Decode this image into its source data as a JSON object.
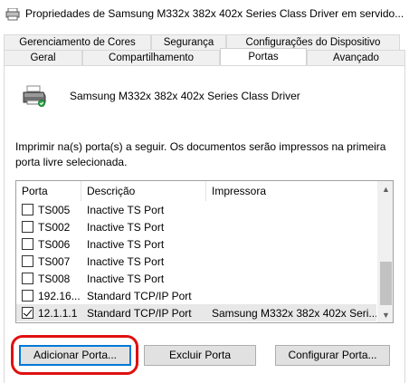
{
  "window": {
    "title": "Propriedades de Samsung M332x 382x 402x Series Class Driver em servido..."
  },
  "tabs": {
    "row1": [
      {
        "label": "Gerenciamento de Cores"
      },
      {
        "label": "Segurança"
      },
      {
        "label": "Configurações do Dispositivo"
      }
    ],
    "row2": [
      {
        "label": "Geral"
      },
      {
        "label": "Compartilhamento"
      },
      {
        "label": "Portas",
        "active": true
      },
      {
        "label": "Avançado"
      }
    ]
  },
  "driver": {
    "name": "Samsung M332x 382x 402x Series Class Driver",
    "icon": "printer-icon"
  },
  "instruction": "Imprimir na(s) porta(s) a seguir. Os documentos serão impressos na primeira porta livre selecionada.",
  "ports_list": {
    "columns": [
      "Porta",
      "Descrição",
      "Impressora"
    ],
    "rows": [
      {
        "checked": false,
        "port": "TS005",
        "description": "Inactive TS Port",
        "printer": ""
      },
      {
        "checked": false,
        "port": "TS002",
        "description": "Inactive TS Port",
        "printer": ""
      },
      {
        "checked": false,
        "port": "TS006",
        "description": "Inactive TS Port",
        "printer": ""
      },
      {
        "checked": false,
        "port": "TS007",
        "description": "Inactive TS Port",
        "printer": ""
      },
      {
        "checked": false,
        "port": "TS008",
        "description": "Inactive TS Port",
        "printer": ""
      },
      {
        "checked": false,
        "port": "192.16...",
        "description": "Standard TCP/IP Port",
        "printer": ""
      },
      {
        "checked": true,
        "port": "12.1.1.1",
        "description": "Standard TCP/IP Port",
        "printer": "Samsung M332x 382x 402x Seri..."
      }
    ]
  },
  "buttons": {
    "add_port": "Adicionar Porta...",
    "delete_port": "Excluir Porta",
    "configure_port": "Configurar Porta..."
  },
  "colors": {
    "highlight_circle": "#e01010",
    "focus_border": "#0078d7"
  }
}
